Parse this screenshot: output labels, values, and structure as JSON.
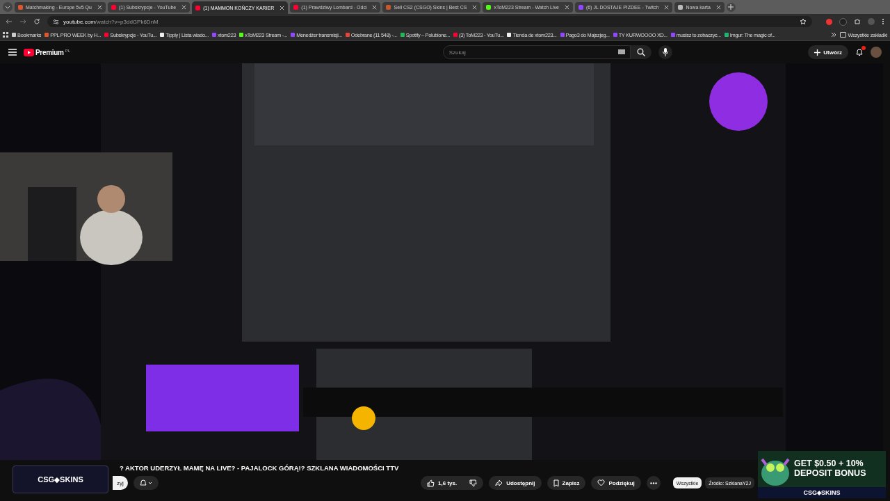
{
  "tabs": [
    {
      "title": "Matchmaking - Europe 5v5 Qu",
      "color": "#e0552b",
      "selected": false
    },
    {
      "title": "(1) Subskrypcje - YouTube",
      "color": "#ff0033",
      "selected": false
    },
    {
      "title": "(1) MAMMON KOŃCZY KARIER",
      "color": "#ff0033",
      "selected": true
    },
    {
      "title": "(1) Prawdziwy Lombard - Odci",
      "color": "#ff0033",
      "selected": false
    },
    {
      "title": "Sell CS2 (CSGO) Skins | Best CS",
      "color": "#c9582a",
      "selected": false
    },
    {
      "title": "xToM223 Stream - Watch Live",
      "color": "#53fc18",
      "selected": false
    },
    {
      "title": "(6) JL DOSTAJE PIZDEE - Twitch",
      "color": "#9146ff",
      "selected": false
    },
    {
      "title": "Nowa karta",
      "color": "#bbbbbb",
      "selected": false
    }
  ],
  "address": {
    "url_host": "youtube.com",
    "url_path": "/watch?v=p3ddGPk6DnM"
  },
  "bookmarks": [
    {
      "label": "Bookmarks",
      "color": "#cccccc"
    },
    {
      "label": "PPL PRO WEEK by H...",
      "color": "#e0552b"
    },
    {
      "label": "Subskrypcje - YouTu...",
      "color": "#ff0033"
    },
    {
      "label": "Tipply | Lista wiado...",
      "color": "#eeeeee"
    },
    {
      "label": "xtom223",
      "color": "#9146ff"
    },
    {
      "label": "xToM223 Stream -...",
      "color": "#53fc18"
    },
    {
      "label": "Menedżer transmisji...",
      "color": "#9146ff"
    },
    {
      "label": "Odebrane (11 548) -...",
      "color": "#ea4335"
    },
    {
      "label": "Spotify – Polubione...",
      "color": "#1db954"
    },
    {
      "label": "(3) ToM223 - YouTu...",
      "color": "#ff0033"
    },
    {
      "label": "Tienda de xtom223...",
      "color": "#eeeeee"
    },
    {
      "label": "Pago3 do Majszjeg...",
      "color": "#9146ff"
    },
    {
      "label": "TY KURWOOOO XD...",
      "color": "#9146ff"
    },
    {
      "label": "musisz to zobaczyc...",
      "color": "#9146ff"
    },
    {
      "label": "Imgur: The magic of...",
      "color": "#1bb76e"
    }
  ],
  "all_bookmarks": "Wszystkie zakładki",
  "youtube": {
    "logo": "Premium",
    "region": "PL",
    "search": {
      "placeholder": "Szukaj"
    },
    "create": "Utwórz"
  },
  "overlay_logo": "CSG⬥SKINS",
  "title": "? AKTOR UDERZYŁ MAMĘ NA LIVE? - PAJALOCK GÓRĄ!? SZKLANA WIADOMOŚCI TTV",
  "subscribe": "zyj",
  "actions": {
    "likes": "1,6 tys.",
    "share": "Udostępnij",
    "save": "Zapisz",
    "thanks": "Podziękuj"
  },
  "chips": [
    {
      "label": "Wszystkie",
      "selected": true
    },
    {
      "label": "Źródło: SzklanaY2J",
      "selected": false
    }
  ],
  "ad": {
    "line_1": "GET $0.50 + 10%",
    "line_2": "DEPOSIT BONUS",
    "brand": "CSG⬥SKINS"
  }
}
